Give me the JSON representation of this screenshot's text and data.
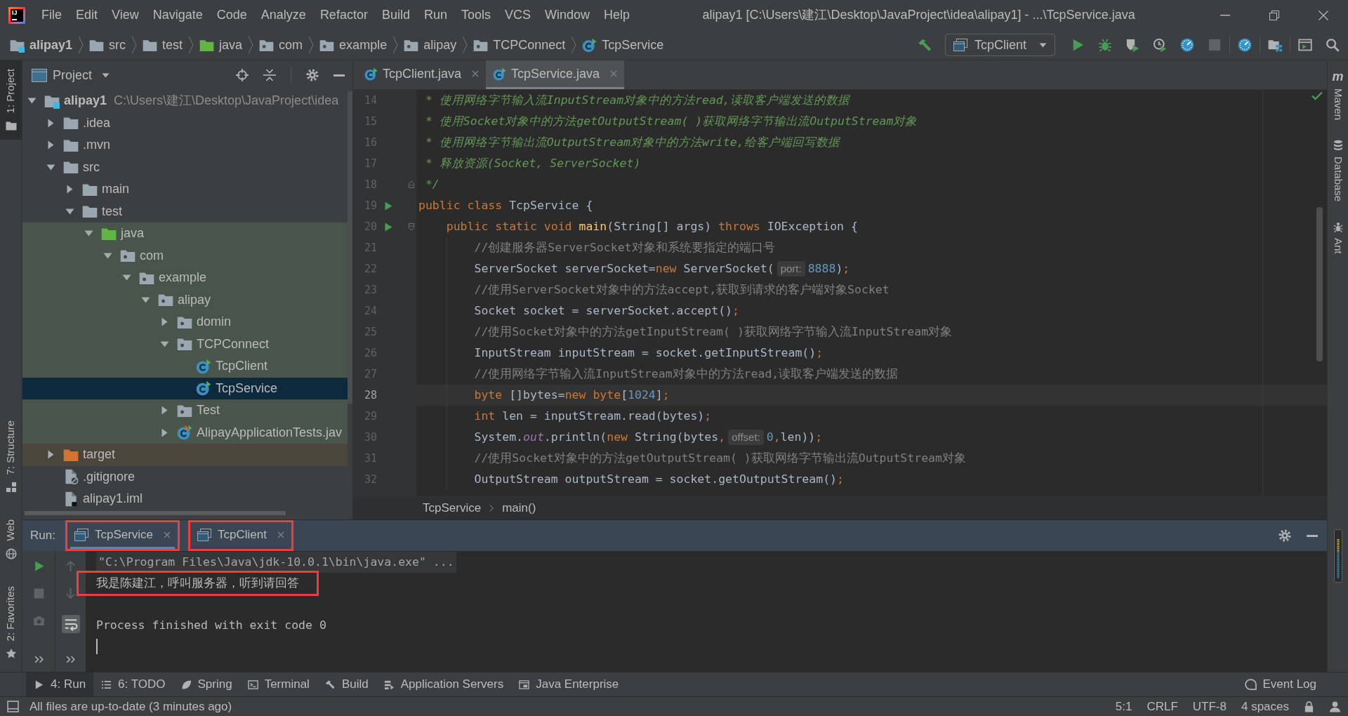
{
  "window": {
    "logo": "IJ",
    "title": "alipay1 [C:\\Users\\建江\\Desktop\\JavaProject\\idea\\alipay1] - ...\\TcpService.java"
  },
  "menu": [
    "File",
    "Edit",
    "View",
    "Navigate",
    "Code",
    "Analyze",
    "Refactor",
    "Build",
    "Run",
    "Tools",
    "VCS",
    "Window",
    "Help"
  ],
  "navigation_bar": {
    "breadcrumbs": [
      {
        "label": "alipay1",
        "kind": "module"
      },
      {
        "label": "src",
        "kind": "folder"
      },
      {
        "label": "test",
        "kind": "folder"
      },
      {
        "label": "java",
        "kind": "test-root"
      },
      {
        "label": "com",
        "kind": "package"
      },
      {
        "label": "example",
        "kind": "package"
      },
      {
        "label": "alipay",
        "kind": "package"
      },
      {
        "label": "TCPConnect",
        "kind": "package"
      },
      {
        "label": "TcpService",
        "kind": "class"
      }
    ],
    "toolbar": [
      {
        "kind": "build",
        "disabled": false
      }
    ],
    "run_configuration": "TcpClient",
    "action_groups": [
      [
        {
          "kind": "run",
          "disabled": false
        },
        {
          "kind": "debug",
          "disabled": false
        },
        {
          "kind": "coverage",
          "disabled": false
        },
        {
          "kind": "profile",
          "disabled": false
        },
        {
          "kind": "gauge",
          "disabled": false
        },
        {
          "kind": "stop",
          "disabled": true
        }
      ],
      [
        {
          "kind": "gauge",
          "disabled": false
        }
      ],
      [
        {
          "kind": "structure",
          "disabled": false
        }
      ],
      [
        {
          "kind": "layout",
          "disabled": false
        },
        {
          "kind": "search",
          "disabled": false
        }
      ]
    ]
  },
  "left_stripe": {
    "top": [
      {
        "label": "1: Project",
        "selected": true
      }
    ],
    "bottom": [
      {
        "label": "7: Structure",
        "selected": false
      },
      {
        "label": "Web",
        "selected": false
      },
      {
        "label": "2: Favorites",
        "selected": false
      }
    ]
  },
  "project_panel": {
    "title": "Project",
    "tree": [
      {
        "label": "alipay1",
        "path": "C:\\Users\\建江\\Desktop\\JavaProject\\idea",
        "kind": "module",
        "expanded": true,
        "selected": false,
        "children": [
          {
            "label": ".idea",
            "kind": "folder",
            "expanded": false,
            "selected": false
          },
          {
            "label": ".mvn",
            "kind": "folder",
            "expanded": false,
            "selected": false
          },
          {
            "label": "src",
            "kind": "folder",
            "expanded": true,
            "selected": false,
            "children": [
              {
                "label": "main",
                "kind": "folder",
                "expanded": false,
                "selected": false
              },
              {
                "label": "test",
                "kind": "folder",
                "expanded": true,
                "selected": false,
                "children": [
                  {
                    "label": "java",
                    "kind": "test-root",
                    "expanded": true,
                    "selected": false,
                    "children": [
                      {
                        "label": "com",
                        "kind": "package",
                        "expanded": true,
                        "selected": false,
                        "children": [
                          {
                            "label": "example",
                            "kind": "package",
                            "expanded": true,
                            "selected": false,
                            "children": [
                              {
                                "label": "alipay",
                                "kind": "package",
                                "expanded": true,
                                "selected": false,
                                "children": [
                                  {
                                    "label": "domin",
                                    "kind": "package",
                                    "expanded": false,
                                    "selected": false
                                  },
                                  {
                                    "label": "TCPConnect",
                                    "kind": "package",
                                    "expanded": true,
                                    "selected": false,
                                    "children": [
                                      {
                                        "label": "TcpClient",
                                        "kind": "class",
                                        "selected": false
                                      },
                                      {
                                        "label": "TcpService",
                                        "kind": "class",
                                        "selected": true
                                      }
                                    ]
                                  },
                                  {
                                    "label": "Test",
                                    "kind": "package",
                                    "expanded": false,
                                    "selected": false
                                  },
                                  {
                                    "label": "AlipayApplicationTests.jav",
                                    "kind": "test-class",
                                    "expanded": false,
                                    "selected": false
                                  }
                                ]
                              }
                            ]
                          }
                        ]
                      }
                    ]
                  }
                ]
              }
            ]
          },
          {
            "label": "target",
            "kind": "excluded",
            "expanded": false,
            "selected": false
          },
          {
            "label": ".gitignore",
            "kind": "ignore-file",
            "selected": false
          },
          {
            "label": "alipay1.iml",
            "kind": "module-file",
            "selected": false
          }
        ]
      }
    ]
  },
  "editor": {
    "tabs": [
      {
        "label": "TcpClient.java",
        "selected": false
      },
      {
        "label": "TcpService.java",
        "selected": true
      }
    ],
    "lines": [
      {
        "number": "14",
        "run": false,
        "fold_start": false,
        "fold_end": false,
        "current": false,
        "tokens": [
          {
            "text": " * 使用网络字节输入流InputStream对象中的方法read,读取客户端发送的数据",
            "kind": "doc"
          }
        ]
      },
      {
        "number": "15",
        "run": false,
        "fold_start": false,
        "fold_end": false,
        "current": false,
        "tokens": [
          {
            "text": " * 使用Socket对象中的方法getOutputStream( )获取网络字节输出流OutputStream对象",
            "kind": "doc"
          }
        ]
      },
      {
        "number": "16",
        "run": false,
        "fold_start": false,
        "fold_end": false,
        "current": false,
        "tokens": [
          {
            "text": " * 使用网络字节输出流OutputStream对象中的方法write,给客户端回写数据",
            "kind": "doc"
          }
        ]
      },
      {
        "number": "17",
        "run": false,
        "fold_start": false,
        "fold_end": false,
        "current": false,
        "tokens": [
          {
            "text": " * 释放资源(Socket, ServerSocket)",
            "kind": "doc"
          }
        ]
      },
      {
        "number": "18",
        "run": false,
        "fold_start": false,
        "fold_end": true,
        "current": false,
        "tokens": [
          {
            "text": " */",
            "kind": "doc"
          }
        ]
      },
      {
        "number": "19",
        "run": true,
        "fold_start": false,
        "fold_end": false,
        "current": false,
        "tokens": [
          {
            "text": "public class ",
            "kind": "keyword"
          },
          {
            "text": "TcpService {",
            "kind": "plain"
          }
        ]
      },
      {
        "number": "20",
        "run": true,
        "fold_start": true,
        "fold_end": false,
        "current": false,
        "tokens": [
          {
            "text": "    public static void ",
            "kind": "keyword"
          },
          {
            "text": "main",
            "kind": "method"
          },
          {
            "text": "(String[] args) ",
            "kind": "plain"
          },
          {
            "text": "throws ",
            "kind": "keyword"
          },
          {
            "text": "IOException {",
            "kind": "plain"
          }
        ]
      },
      {
        "number": "21",
        "run": false,
        "fold_start": false,
        "fold_end": false,
        "current": false,
        "tokens": [
          {
            "text": "        //创建服务器ServerSocket对象和系统要指定的端口号",
            "kind": "comment"
          }
        ]
      },
      {
        "number": "22",
        "run": false,
        "fold_start": false,
        "fold_end": false,
        "current": false,
        "tokens": [
          {
            "text": "        ServerSocket serverSocket=",
            "kind": "plain"
          },
          {
            "text": "new ",
            "kind": "keyword"
          },
          {
            "text": "ServerSocket(",
            "kind": "plain"
          },
          {
            "text": "port:",
            "kind": "hint"
          },
          {
            "text": "8888",
            "kind": "number"
          },
          {
            "text": ")",
            "kind": "plain"
          },
          {
            "text": ";",
            "kind": "punct"
          }
        ]
      },
      {
        "number": "23",
        "run": false,
        "fold_start": false,
        "fold_end": false,
        "current": false,
        "tokens": [
          {
            "text": "        //使用ServerSocket对象中的方法accept,获取到请求的客户端对象Socket",
            "kind": "comment"
          }
        ]
      },
      {
        "number": "24",
        "run": false,
        "fold_start": false,
        "fold_end": false,
        "current": false,
        "tokens": [
          {
            "text": "        Socket socket = serverSocket.accept()",
            "kind": "plain"
          },
          {
            "text": ";",
            "kind": "punct"
          }
        ]
      },
      {
        "number": "25",
        "run": false,
        "fold_start": false,
        "fold_end": false,
        "current": false,
        "tokens": [
          {
            "text": "        //使用Socket对象中的方法getInputStream( )获取网络字节输入流InputStream对象",
            "kind": "comment"
          }
        ]
      },
      {
        "number": "26",
        "run": false,
        "fold_start": false,
        "fold_end": false,
        "current": false,
        "tokens": [
          {
            "text": "        InputStream inputStream = socket.getInputStream()",
            "kind": "plain"
          },
          {
            "text": ";",
            "kind": "punct"
          }
        ]
      },
      {
        "number": "27",
        "run": false,
        "fold_start": false,
        "fold_end": false,
        "current": false,
        "tokens": [
          {
            "text": "        //使用网络字节输入流InputStream对象中的方法read,读取客户端发送的数据",
            "kind": "comment"
          }
        ]
      },
      {
        "number": "28",
        "run": false,
        "fold_start": false,
        "fold_end": false,
        "current": true,
        "tokens": [
          {
            "text": "        byte ",
            "kind": "keyword"
          },
          {
            "text": "[]bytes=",
            "kind": "plain"
          },
          {
            "text": "new ",
            "kind": "keyword"
          },
          {
            "text": "byte",
            "kind": "keyword"
          },
          {
            "text": "[",
            "kind": "plain"
          },
          {
            "text": "1024",
            "kind": "number"
          },
          {
            "text": "]",
            "kind": "plain"
          },
          {
            "text": ";",
            "kind": "punct"
          }
        ]
      },
      {
        "number": "29",
        "run": false,
        "fold_start": false,
        "fold_end": false,
        "current": false,
        "tokens": [
          {
            "text": "        int ",
            "kind": "keyword"
          },
          {
            "text": "len = inputStream.read(bytes)",
            "kind": "plain"
          },
          {
            "text": ";",
            "kind": "punct"
          }
        ]
      },
      {
        "number": "30",
        "run": false,
        "fold_start": false,
        "fold_end": false,
        "current": false,
        "tokens": [
          {
            "text": "        System.",
            "kind": "plain"
          },
          {
            "text": "out",
            "kind": "static"
          },
          {
            "text": ".println(",
            "kind": "plain"
          },
          {
            "text": "new ",
            "kind": "keyword"
          },
          {
            "text": "String(bytes",
            "kind": "plain"
          },
          {
            "text": ",",
            "kind": "punct"
          },
          {
            "text": "offset:",
            "kind": "hint"
          },
          {
            "text": "0",
            "kind": "number"
          },
          {
            "text": ",",
            "kind": "punct"
          },
          {
            "text": "len))",
            "kind": "plain"
          },
          {
            "text": ";",
            "kind": "punct"
          }
        ]
      },
      {
        "number": "31",
        "run": false,
        "fold_start": false,
        "fold_end": false,
        "current": false,
        "tokens": [
          {
            "text": "        //使用Socket对象中的方法getOutputStream( )获取网络字节输出流OutputStream对象",
            "kind": "comment"
          }
        ]
      },
      {
        "number": "32",
        "run": false,
        "fold_start": false,
        "fold_end": false,
        "current": false,
        "tokens": [
          {
            "text": "        OutputStream outputStream = socket.getOutputStream()",
            "kind": "plain"
          },
          {
            "text": ";",
            "kind": "punct"
          }
        ]
      }
    ],
    "breadcrumbs": [
      "TcpService",
      "main()"
    ]
  },
  "right_stripe": [
    {
      "label": "Maven",
      "glyph": "m",
      "selected": false
    },
    {
      "label": "Database",
      "selected": false
    },
    {
      "label": "Ant",
      "selected": false
    }
  ],
  "run_panel": {
    "label": "Run:",
    "tabs": [
      {
        "label": "TcpService",
        "selected": true,
        "outlined": true
      },
      {
        "label": "TcpClient",
        "selected": false,
        "outlined": true
      }
    ],
    "toolbar": [
      {
        "kind": "run",
        "disabled": false
      },
      {
        "kind": "stop",
        "disabled": true
      },
      {
        "kind": "snapshot",
        "disabled": true
      },
      {
        "kind": "more"
      }
    ],
    "toolbar_2": [
      {
        "kind": "up",
        "disabled": true
      },
      {
        "kind": "down",
        "disabled": true
      },
      {
        "kind": "soft-wrap",
        "on": true
      },
      {
        "kind": "more"
      }
    ],
    "console": [
      {
        "text": "\"C:\\Program Files\\Java\\jdk-10.0.1\\bin\\java.exe\" ...",
        "kind": "command",
        "outlined": false
      },
      {
        "text": "我是陈建江，呼叫服务器，听到请回答",
        "kind": "output",
        "outlined": true
      },
      {
        "text": "Process finished with exit code 0",
        "kind": "exit",
        "outlined": false
      }
    ]
  },
  "bottom_bar": {
    "tools": [
      {
        "label": "4: Run",
        "selected": true
      },
      {
        "label": "6: TODO",
        "selected": false
      },
      {
        "label": "Spring",
        "selected": false
      },
      {
        "label": "Terminal",
        "selected": false
      },
      {
        "label": "Build",
        "selected": false
      },
      {
        "label": "Application Servers",
        "selected": false
      },
      {
        "label": "Java Enterprise",
        "selected": false
      }
    ],
    "event_log": "Event Log"
  },
  "status_bar": {
    "message": "All files are up-to-date (3 minutes ago)",
    "position": "5:1",
    "line_separator": "CRLF",
    "encoding": "UTF-8",
    "indent": "4 spaces"
  }
}
